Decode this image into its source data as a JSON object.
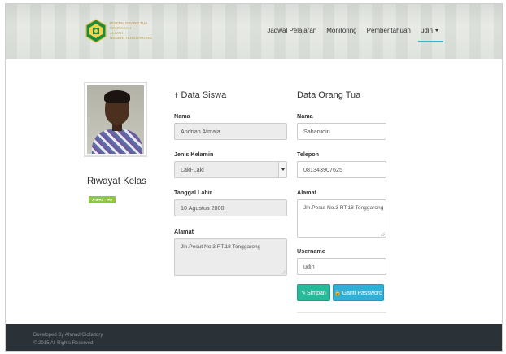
{
  "header": {
    "logo_lines": [
      "PORTAL ORANG TUA",
      "MADRASAH",
      "ALIYAH",
      "NEGERI TENGGARONG"
    ],
    "nav": [
      {
        "label": "Jadwal Pelajaran"
      },
      {
        "label": "Monitoring"
      },
      {
        "label": "Pemberitahuan"
      },
      {
        "label": "udin"
      }
    ]
  },
  "sidebar": {
    "riwayat_title": "Riwayat Kelas",
    "badge": "X-IPA1 - IPA"
  },
  "data_siswa": {
    "title": "Data Siswa",
    "nama_label": "Nama",
    "nama_value": "Andrian Atmaja",
    "jk_label": "Jenis Kelamin",
    "jk_value": "Laki-Laki",
    "tgl_label": "Tanggal Lahir",
    "tgl_value": "10 Agustus 2000",
    "alamat_label": "Alamat",
    "alamat_value": "Jln.Pesut No.3 RT.18 Tenggarong"
  },
  "data_ortu": {
    "title": "Data Orang Tua",
    "nama_label": "Nama",
    "nama_value": "Saharudin",
    "telp_label": "Telepon",
    "telp_value": "081343907625",
    "alamat_label": "Alamat",
    "alamat_value": "Jln.Pesut No.3 RT.18 Tenggarong",
    "username_label": "Username",
    "username_value": "udin",
    "simpan_label": "Simpan",
    "ganti_label": "Ganti Password"
  },
  "footer": {
    "line1": "Developed By Ahmad Giofattory",
    "line2": "© 2015 All Rights Reserved"
  },
  "colors": {
    "accent": "#3cb6c9",
    "simpan": "#26b99a",
    "ganti": "#31b0d5",
    "badge": "#8dc63f",
    "footer": "#2a3238"
  }
}
